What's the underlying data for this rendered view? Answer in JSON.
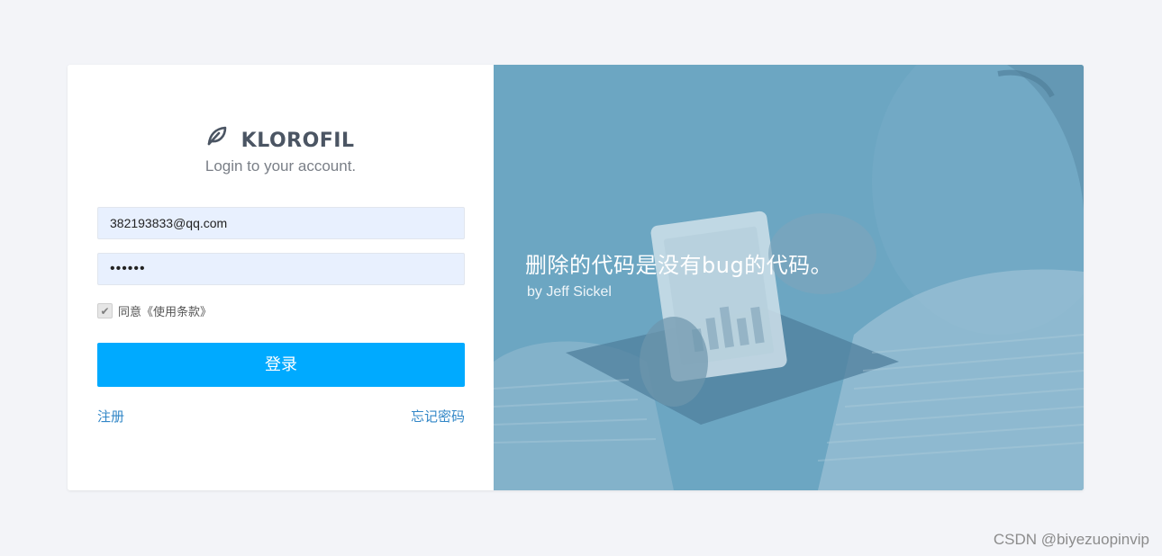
{
  "brand": {
    "name": "KLOROFIL",
    "tagline": "Login to your account."
  },
  "form": {
    "email_value": "382193833@qq.com",
    "password_value": "••••••",
    "agree_label": "同意《使用条款》",
    "agree_checked": true,
    "login_label": "登录",
    "register_label": "注册",
    "forgot_label": "忘记密码"
  },
  "hero": {
    "quote": "删除的代码是没有bug的代码。",
    "author": "by Jeff Sickel"
  },
  "watermark": "CSDN @biyezuopinvip",
  "colors": {
    "accent": "#00aaff",
    "link": "#3287c7",
    "hero_overlay": "#6aa5c1",
    "input_bg": "#e8f0fe"
  },
  "icons": {
    "logo": "leaf-icon",
    "checkbox": "check-icon"
  }
}
